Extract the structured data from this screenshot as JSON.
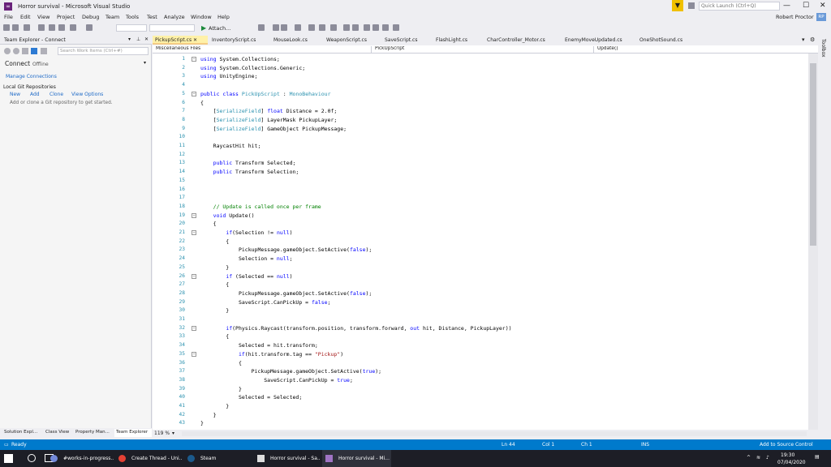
{
  "window": {
    "title": "Horror survival - Microsoft Visual Studio",
    "quick_launch_placeholder": "Quick Launch (Ctrl+Q)",
    "user": "Robert Proctor",
    "user_initials": "RP",
    "controls": [
      "—",
      "☐",
      "✕"
    ]
  },
  "menu": [
    "File",
    "Edit",
    "View",
    "Project",
    "Debug",
    "Team",
    "Tools",
    "Test",
    "Analyze",
    "Window",
    "Help"
  ],
  "toolbar": {
    "attach_label": "Attach..."
  },
  "left_panel": {
    "title": "Team Explorer - Connect",
    "search_placeholder": "Search Work Items (Ctrl+#)",
    "connect_label": "Connect",
    "offline_label": "Offline",
    "manage_label": "Manage Connections",
    "local_git_label": "Local Git Repositories",
    "actions": [
      "New",
      "Add",
      "Clone",
      "View Options"
    ],
    "hint": "Add or clone a Git repository to get started."
  },
  "bottom_tabs": [
    "Solution Expl...",
    "Class View",
    "Property Man...",
    "Team Explorer"
  ],
  "doc_tabs": [
    "PickupScript.cs",
    "InventoryScript.cs",
    "MouseLook.cs",
    "WeaponScript.cs",
    "SaveScript.cs",
    "FlashLight.cs",
    "CharController_Motor.cs",
    "EnemyMoveUpdated.cs",
    "OneShotSound.cs"
  ],
  "nav_bar": {
    "project": "Miscellaneous Files",
    "class": "PickUpScript",
    "member": "Update()"
  },
  "code_lines": [
    "using System.Collections;",
    "using System.Collections.Generic;",
    "using UnityEngine;",
    "",
    "public class PickUpScript : MonoBehaviour",
    "{",
    "    [SerializeField] float Distance = 2.0f;",
    "    [SerializeField] LayerMask PickupLayer;",
    "    [SerializeField] GameObject PickupMessage;",
    "",
    "    RaycastHit hit;",
    "",
    "    public Transform Selected;",
    "    public Transform Selection;",
    "",
    "",
    "",
    "    // Update is called once per frame",
    "    void Update()",
    "    {",
    "        if(Selection != null)",
    "        {",
    "            PickupMessage.gameObject.SetActive(false);",
    "            Selection = null;",
    "        }",
    "        if (Selected == null)",
    "        {",
    "            PickupMessage.gameObject.SetActive(false);",
    "            SaveScript.CanPickUp = false;",
    "        }",
    "",
    "        if(Physics.Raycast(transform.position, transform.forward, out hit, Distance, PickupLayer))",
    "        {",
    "            Selected = hit.transform;",
    "            if(hit.transform.tag == \"Pickup\")",
    "            {",
    "                PickupMessage.gameObject.SetActive(true);",
    "                    SaveScript.CanPickUp = true;",
    "            }",
    "            Selected = Selected;",
    "        }",
    "    }",
    "}"
  ],
  "zoom": "119 %",
  "status": {
    "ready": "Ready",
    "ln": "Ln 44",
    "col": "Col 1",
    "ch": "Ch 1",
    "ins": "INS",
    "source_control": "Add to Source Control"
  },
  "taskbar": {
    "search_placeholder": "",
    "buttons": [
      "#works-in-progress...",
      "Create Thread - Uni...",
      "Steam",
      "Horror survival - Sa...",
      "Horror survival - Mi..."
    ],
    "time": "19:30",
    "date": "07/04/2020"
  },
  "toolbox_label": "Toolbox",
  "colors": {
    "accent": "#007acc",
    "active_tab": "#fff1a8",
    "keyword": "#0000ff",
    "type": "#2b91af",
    "string": "#a31515",
    "comment": "#008000"
  }
}
